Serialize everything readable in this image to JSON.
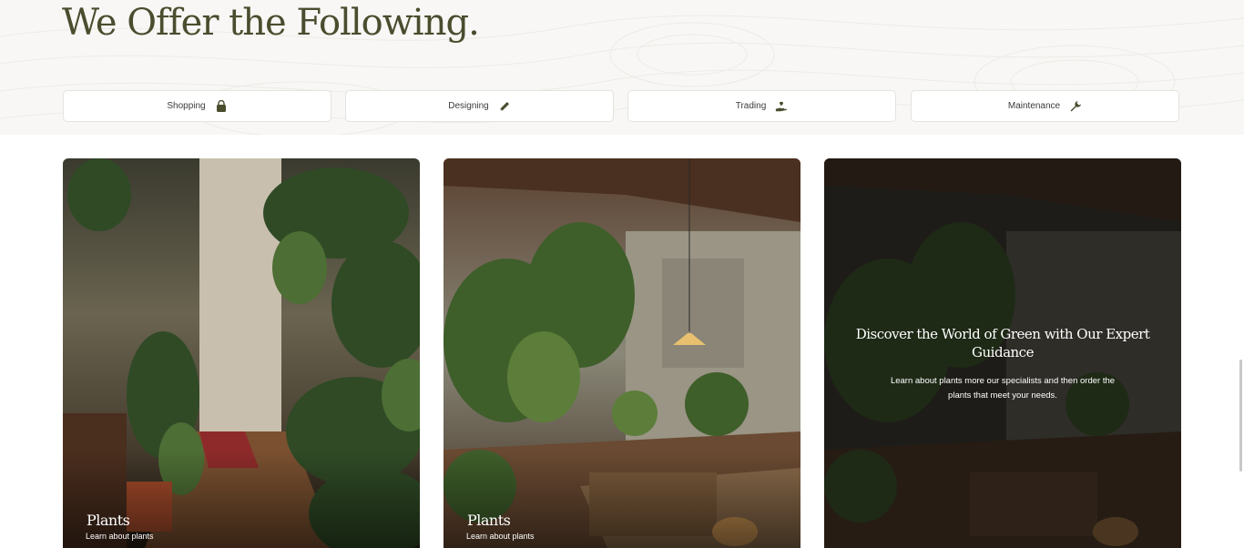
{
  "section": {
    "heading": "We Offer the Following."
  },
  "services": [
    {
      "label": "Shopping",
      "icon": "shopping-bag-icon"
    },
    {
      "label": "Designing",
      "icon": "pencil-icon"
    },
    {
      "label": "Trading",
      "icon": "hand-plant-icon"
    },
    {
      "label": "Maintenance",
      "icon": "wrench-icon"
    }
  ],
  "cards": [
    {
      "title": "Plants",
      "subtitle": "Learn about plants"
    },
    {
      "title": "Plants",
      "subtitle": "Learn about plants"
    },
    {
      "overlay_title": "Discover the World of Green with Our Expert Guidance",
      "overlay_text": "Learn about plants more our specialists and then order the plants that meet your needs."
    }
  ],
  "colors": {
    "heading": "#4a4d2e",
    "icon": "#4a4d2e",
    "hero_bg": "#f8f7f5"
  }
}
